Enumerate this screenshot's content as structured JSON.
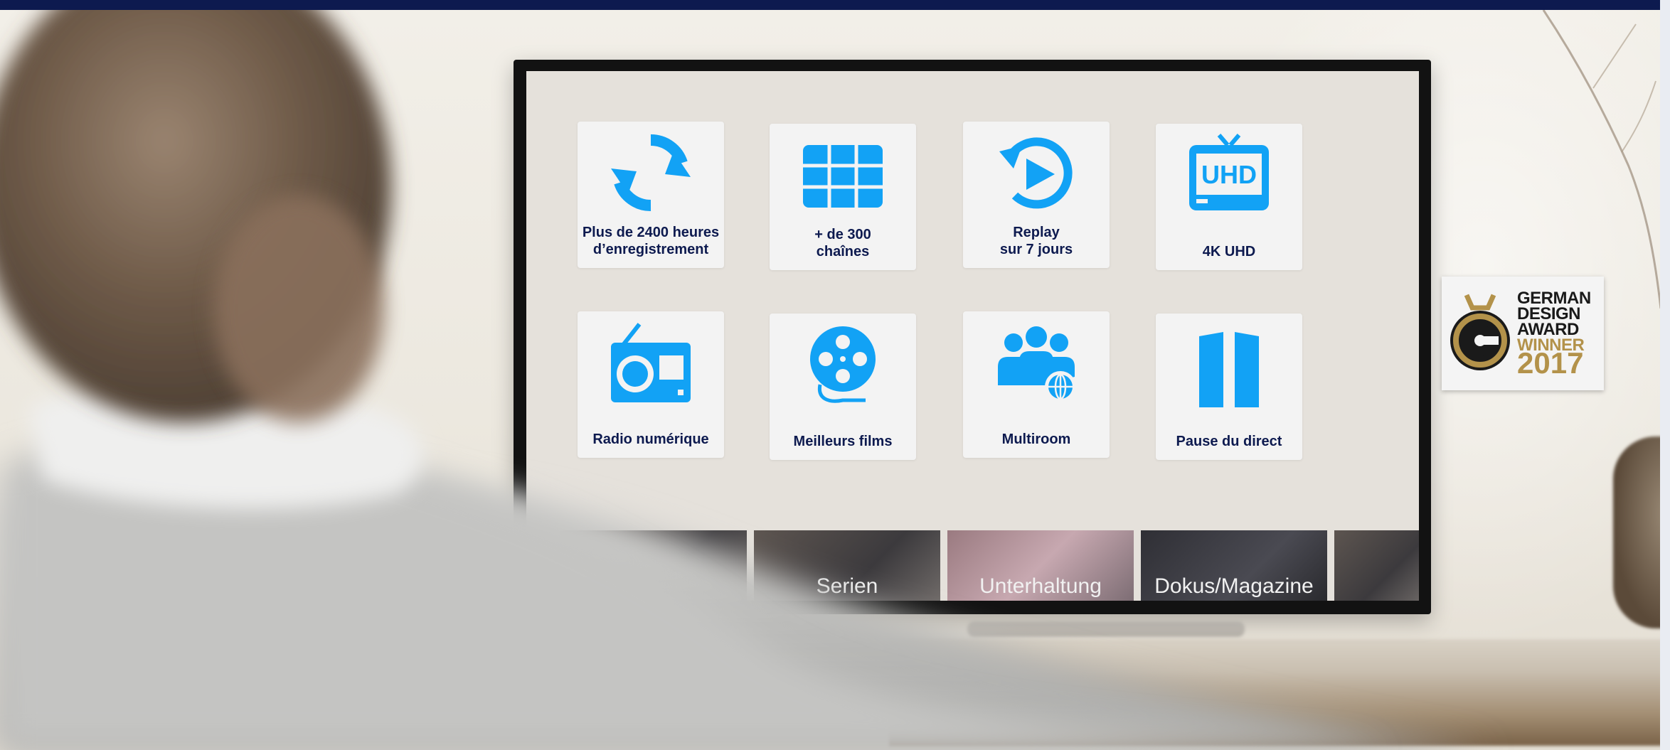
{
  "features": [
    {
      "label": "Plus de 2400 heures\nd’enregistrement",
      "icon": "recording-cycle-icon"
    },
    {
      "label": "+ de 300\nchaînes",
      "icon": "channel-grid-icon"
    },
    {
      "label": "Replay\nsur 7 jours",
      "icon": "replay-play-icon"
    },
    {
      "label": "4K UHD",
      "icon": "uhd-tv-icon"
    },
    {
      "label": "Radio numérique",
      "icon": "radio-icon"
    },
    {
      "label": "Meilleurs films",
      "icon": "film-reel-icon"
    },
    {
      "label": "Multiroom",
      "icon": "multiroom-users-icon"
    },
    {
      "label": "Pause du direct",
      "icon": "pause-icon"
    }
  ],
  "categories": [
    "",
    "Serien",
    "Unterhaltung",
    "Dokus/Magazine",
    ""
  ],
  "award": {
    "line1": "GERMAN",
    "line2": "DESIGN",
    "line3": "AWARD",
    "line4": "WINNER",
    "year": "2017"
  },
  "colors": {
    "accent": "#12a2f5",
    "label": "#0d1a4f",
    "top_bar": "#0d1a4f",
    "award_gold": "#b3924a"
  }
}
